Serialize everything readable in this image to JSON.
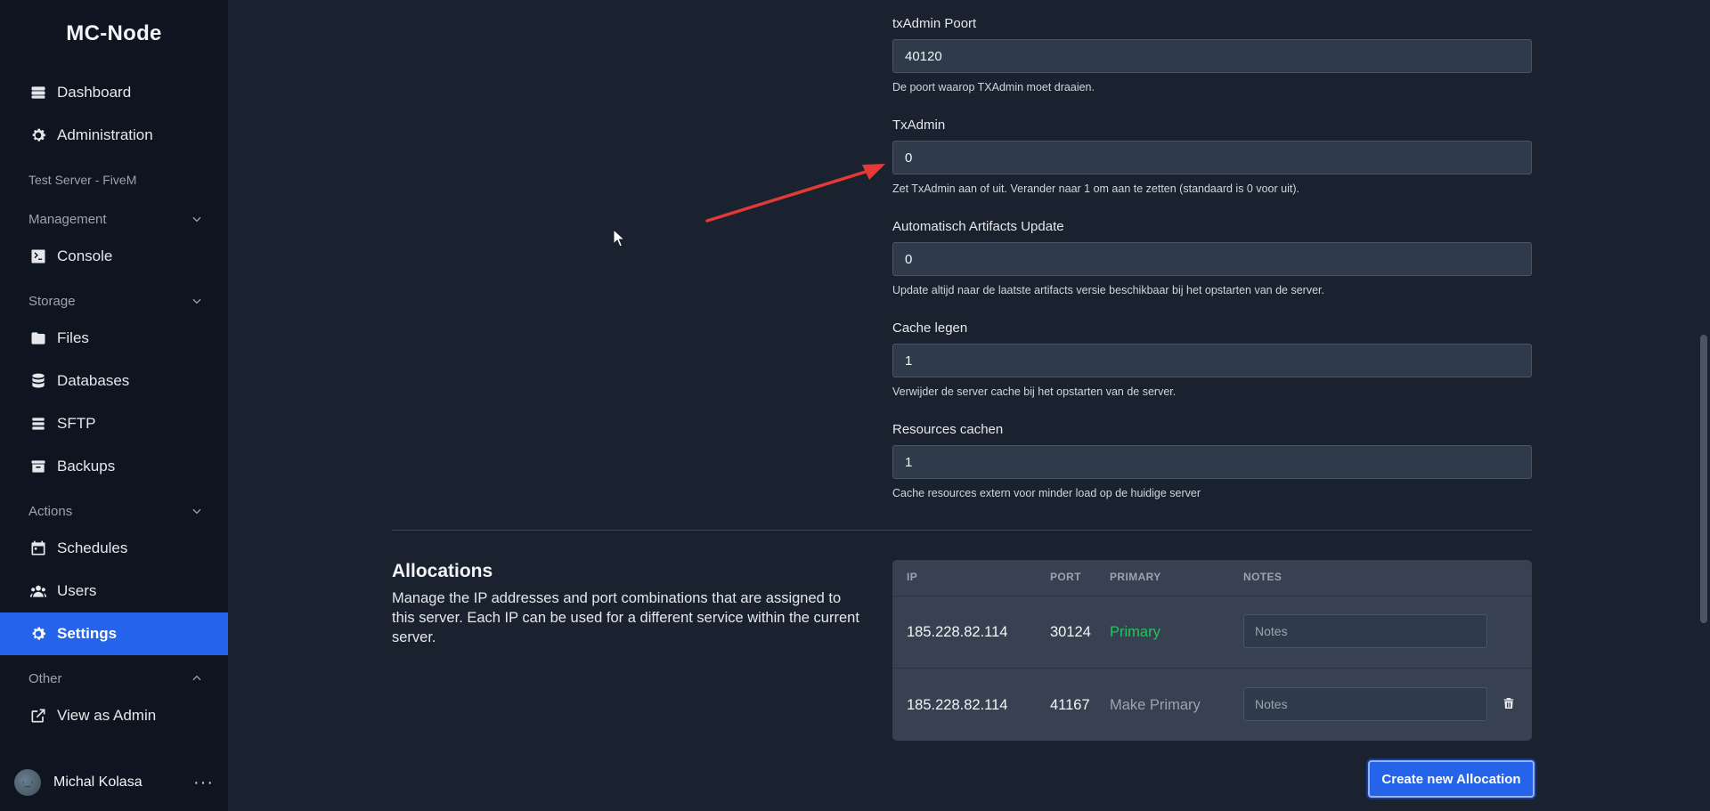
{
  "brand": "MC-Node",
  "sidebar": {
    "nav_top": [
      {
        "label": "Dashboard",
        "icon": "server-stack-icon"
      },
      {
        "label": "Administration",
        "icon": "gear-icon"
      }
    ],
    "server_name": "Test Server - FiveM",
    "sections": [
      {
        "title": "Management",
        "expanded": true,
        "items": [
          {
            "label": "Console",
            "icon": "terminal-icon"
          }
        ]
      },
      {
        "title": "Storage",
        "expanded": true,
        "items": [
          {
            "label": "Files",
            "icon": "folder-icon"
          },
          {
            "label": "Databases",
            "icon": "database-icon"
          },
          {
            "label": "SFTP",
            "icon": "layers-icon"
          },
          {
            "label": "Backups",
            "icon": "archive-icon"
          }
        ]
      },
      {
        "title": "Actions",
        "expanded": true,
        "items": [
          {
            "label": "Schedules",
            "icon": "calendar-icon"
          },
          {
            "label": "Users",
            "icon": "users-icon"
          },
          {
            "label": "Settings",
            "icon": "gear-icon",
            "active": true
          }
        ]
      },
      {
        "title": "Other",
        "expanded": false,
        "items": [
          {
            "label": "View as Admin",
            "icon": "external-link-icon"
          }
        ]
      }
    ],
    "user": {
      "name": "Michal Kolasa",
      "avatar_text": "·_·",
      "menu": "···"
    }
  },
  "variables": [
    {
      "label": "txAdmin Poort",
      "value": "40120",
      "help": "De poort waarop TXAdmin moet draaien."
    },
    {
      "label": "TxAdmin",
      "value": "0",
      "help": "Zet TxAdmin aan of uit. Verander naar 1 om aan te zetten (standaard is 0 voor uit)."
    },
    {
      "label": "Automatisch Artifacts Update",
      "value": "0",
      "help": "Update altijd naar de laatste artifacts versie beschikbaar bij het opstarten van de server."
    },
    {
      "label": "Cache legen",
      "value": "1",
      "help": "Verwijder de server cache bij het opstarten van de server."
    },
    {
      "label": "Resources cachen",
      "value": "1",
      "help": "Cache resources extern voor minder load op de huidige server"
    }
  ],
  "allocations": {
    "title": "Allocations",
    "description": "Manage the IP addresses and port combinations that are assigned to this server. Each IP can be used for a different service within the current server.",
    "headers": {
      "ip": "IP",
      "port": "PORT",
      "primary": "PRIMARY",
      "notes": "NOTES"
    },
    "rows": [
      {
        "ip": "185.228.82.114",
        "port": "30124",
        "primary": "Primary",
        "notes_placeholder": "Notes"
      },
      {
        "ip": "185.228.82.114",
        "port": "41167",
        "primary": "Make Primary",
        "notes_placeholder": "Notes"
      }
    ],
    "create_label": "Create new Allocation"
  },
  "colors": {
    "accent": "#2563eb",
    "primary_green": "#22c55e",
    "annotation_arrow": "#e53935"
  }
}
